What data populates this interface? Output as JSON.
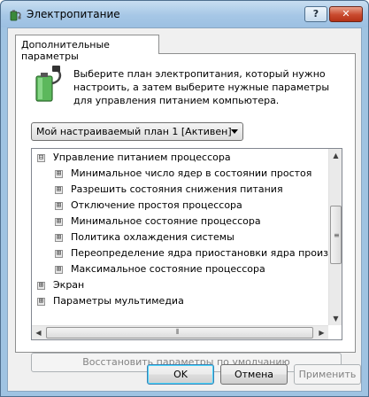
{
  "window": {
    "title": "Электропитание",
    "help_label": "?",
    "close_label": "✕"
  },
  "tab": {
    "label": "Дополнительные параметры"
  },
  "description": "Выберите план электропитания, который нужно настроить, а затем выберите нужные параметры для управления питанием компьютера.",
  "plan_select": {
    "value": "Мой настраиваемый план 1 [Активен]"
  },
  "tree": {
    "rows": [
      {
        "label": "Управление питанием процессора",
        "expander": "⊟",
        "level": 0
      },
      {
        "label": "Минимальное число ядер в состоянии простоя",
        "expander": "⊞",
        "level": 1
      },
      {
        "label": "Разрешить состояния снижения питания",
        "expander": "⊞",
        "level": 1
      },
      {
        "label": "Отключение простоя процессора",
        "expander": "⊞",
        "level": 1
      },
      {
        "label": "Минимальное состояние процессора",
        "expander": "⊞",
        "level": 1
      },
      {
        "label": "Политика охлаждения системы",
        "expander": "⊞",
        "level": 1
      },
      {
        "label": "Переопределение ядра приостановки ядра произво…",
        "expander": "⊞",
        "level": 1
      },
      {
        "label": "Максимальное состояние процессора",
        "expander": "⊞",
        "level": 1
      },
      {
        "label": "Экран",
        "expander": "⊞",
        "level": 0
      },
      {
        "label": "Параметры мультимедиа",
        "expander": "⊞",
        "level": 0
      }
    ]
  },
  "buttons": {
    "restore": "Восстановить параметры по умолчанию",
    "ok": "OK",
    "cancel": "Отмена",
    "apply": "Применить"
  },
  "colors": {
    "titlebar": "#a6c7e6",
    "close_button": "#c94a2e",
    "dialog_bg": "#f0f0f0",
    "disabled_text": "#838383"
  }
}
